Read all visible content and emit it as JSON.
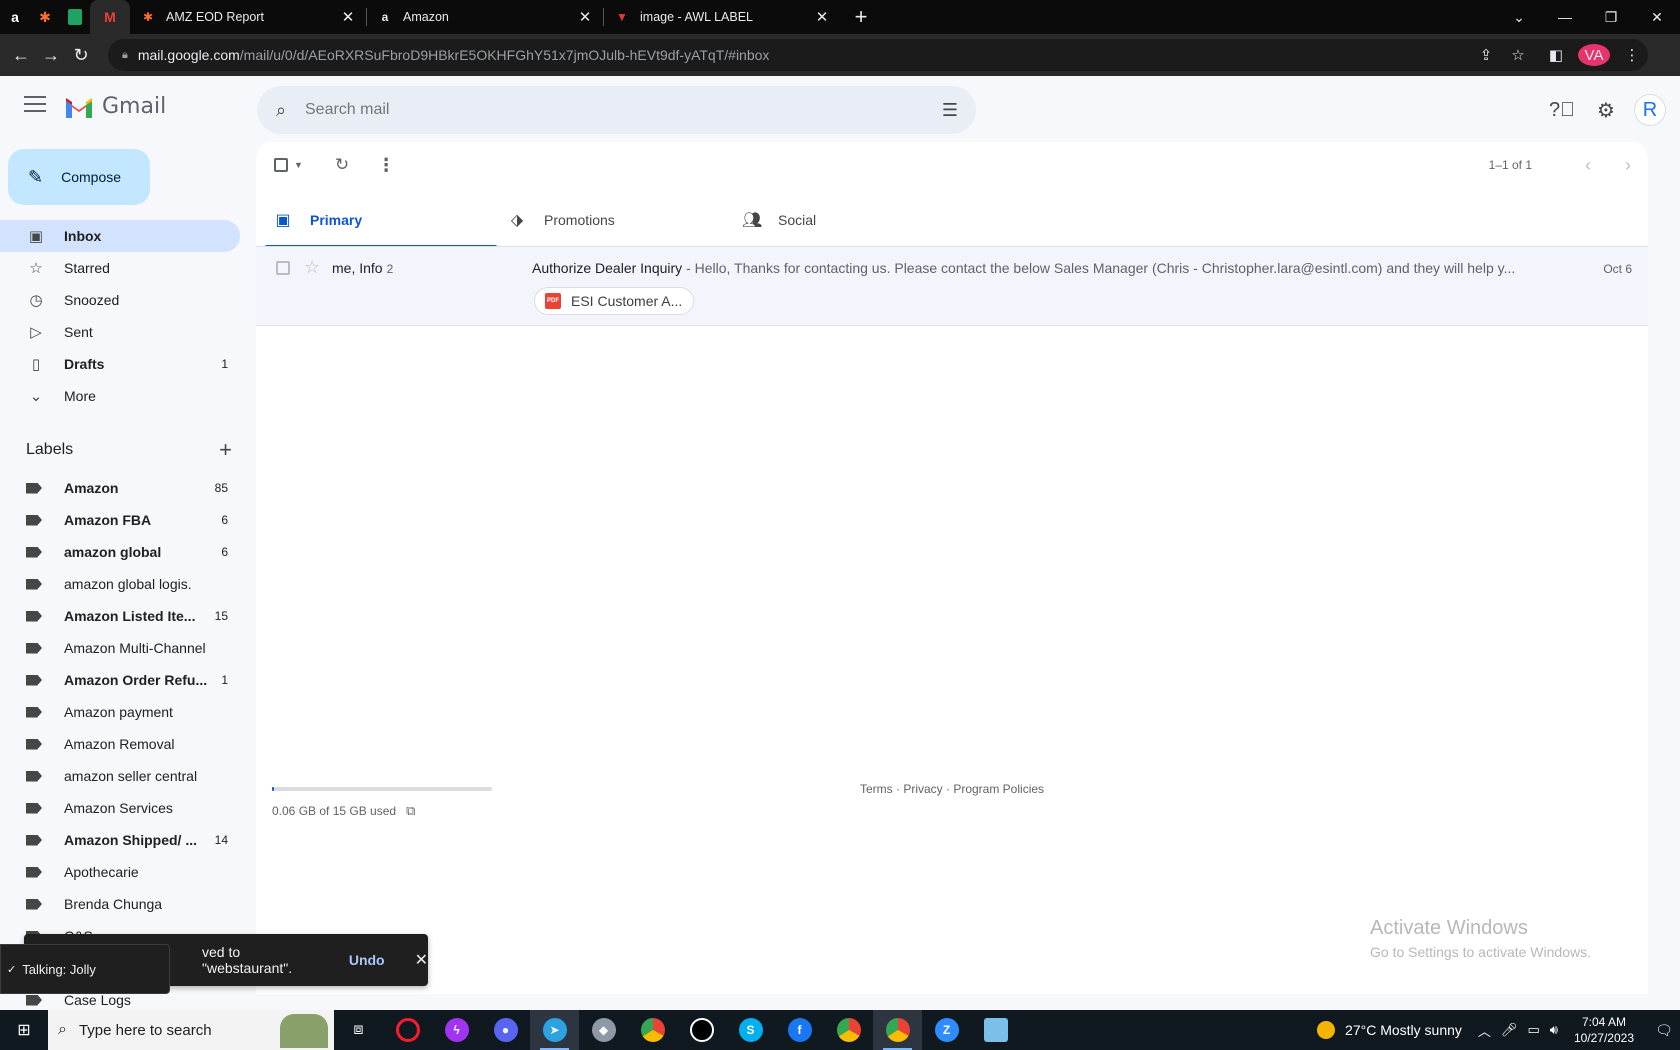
{
  "browser": {
    "tabs": [
      {
        "label": "AMZ EOD Report",
        "icon": "zapier-icon"
      },
      {
        "label": "Amazon",
        "icon": "amazon-icon"
      },
      {
        "label": "image - AWL LABEL",
        "icon": "awl-icon"
      }
    ],
    "url_domain": "mail.google.com",
    "url_path": "/mail/u/0/d/AEoRXRSuFbroD9HBkrE5OKHFGhY51x7jmOJulb-hEVt9df-yATqT/#inbox",
    "profile_initials": "VA"
  },
  "gmail": {
    "app_name": "Gmail",
    "search_placeholder": "Search mail",
    "avatar_initial": "R",
    "compose_label": "Compose",
    "nav": [
      {
        "label": "Inbox",
        "icon": "inbox-icon",
        "count": ""
      },
      {
        "label": "Starred",
        "icon": "star-icon",
        "count": ""
      },
      {
        "label": "Snoozed",
        "icon": "clock-icon",
        "count": ""
      },
      {
        "label": "Sent",
        "icon": "send-icon",
        "count": ""
      },
      {
        "label": "Drafts",
        "icon": "draft-icon",
        "count": "1"
      },
      {
        "label": "More",
        "icon": "chevron-down-icon",
        "count": ""
      }
    ],
    "labels_heading": "Labels",
    "labels": [
      {
        "label": "Amazon",
        "count": "85",
        "bold": true
      },
      {
        "label": "Amazon FBA",
        "count": "6",
        "bold": true
      },
      {
        "label": "amazon global",
        "count": "6",
        "bold": true
      },
      {
        "label": "amazon global logis.",
        "count": "",
        "bold": false
      },
      {
        "label": "Amazon Listed Ite...",
        "count": "15",
        "bold": true
      },
      {
        "label": "Amazon Multi-Channel",
        "count": "",
        "bold": false
      },
      {
        "label": "Amazon Order Refu...",
        "count": "1",
        "bold": true
      },
      {
        "label": "Amazon payment",
        "count": "",
        "bold": false
      },
      {
        "label": "Amazon Removal",
        "count": "",
        "bold": false
      },
      {
        "label": "amazon seller central",
        "count": "",
        "bold": false
      },
      {
        "label": "Amazon Services",
        "count": "",
        "bold": false
      },
      {
        "label": "Amazon Shipped/ ...",
        "count": "14",
        "bold": true
      },
      {
        "label": "Apothecarie",
        "count": "",
        "bold": false
      },
      {
        "label": "Brenda Chunga",
        "count": "",
        "bold": false
      },
      {
        "label": "C&S",
        "count": "",
        "bold": false
      },
      {
        "label": "",
        "count": "",
        "bold": false
      },
      {
        "label": "Case Logs",
        "count": "",
        "bold": false
      }
    ],
    "pager_text": "1–1 of 1",
    "category_tabs": [
      {
        "label": "Primary",
        "icon": "inbox-icon"
      },
      {
        "label": "Promotions",
        "icon": "tag-icon"
      },
      {
        "label": "Social",
        "icon": "people-icon"
      }
    ],
    "email": {
      "sender": "me, Info",
      "thread_count": "2",
      "subject": "Authorize Dealer Inquiry",
      "snippet": " - Hello, Thanks for contacting us. Please contact the below Sales Manager (Chris - Christopher.lara@esintl.com) and they will help y...",
      "date": "Oct 6",
      "attachment": "ESI Customer A...",
      "attachment_type": "PDF"
    },
    "storage_text": "0.06 GB of 15 GB used",
    "storage_fraction": 0.004,
    "footer": "Terms · Privacy · Program Policies",
    "snackbar": {
      "message": "ved to \"webstaurant\".",
      "action": "Undo"
    },
    "talking_toast": "Talking: Jolly"
  },
  "watermark": {
    "line1": "Activate Windows",
    "line2": "Go to Settings to activate Windows."
  },
  "taskbar": {
    "search_placeholder": "Type here to search",
    "weather": "27°C  Mostly sunny",
    "time": "7:04 AM",
    "date": "10/27/2023",
    "notification_count": "1"
  }
}
